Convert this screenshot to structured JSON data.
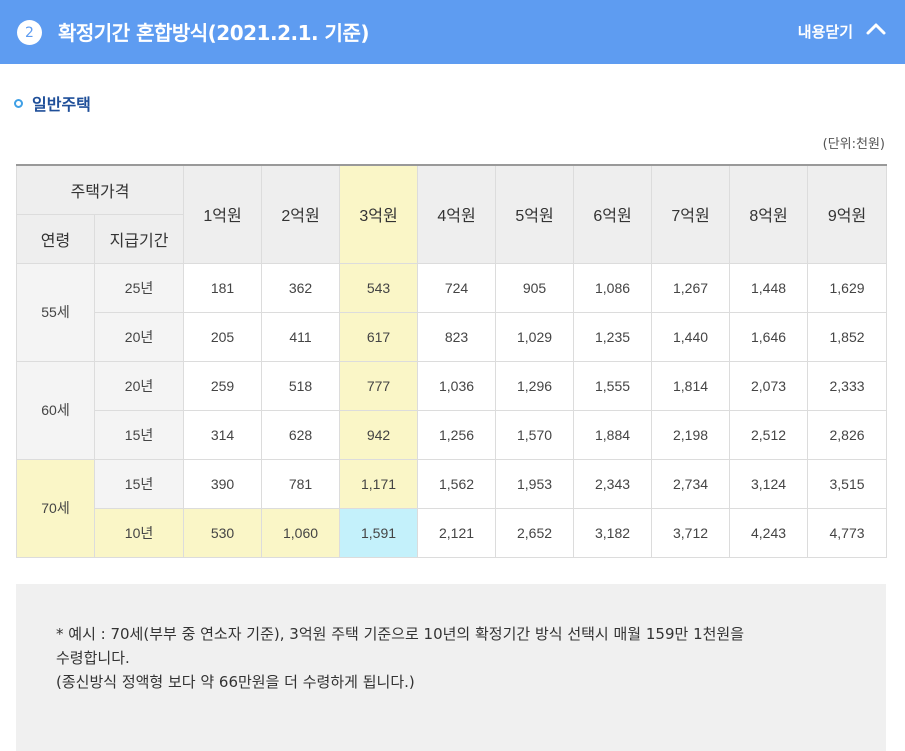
{
  "header": {
    "number": "2",
    "title": "확정기간 혼합방식(2021.2.1. 기준)",
    "close_label": "내용닫기"
  },
  "section": {
    "title": "일반주택"
  },
  "unit": "(단위:천원)",
  "table": {
    "header_price": "주택가격",
    "header_age": "연령",
    "header_period": "지급기간",
    "prices": [
      "1억원",
      "2억원",
      "3억원",
      "4억원",
      "5억원",
      "6억원",
      "7억원",
      "8억원",
      "9억원"
    ],
    "groups": [
      {
        "age": "55세",
        "rows": [
          {
            "period": "25년",
            "values": [
              "181",
              "362",
              "543",
              "724",
              "905",
              "1,086",
              "1,267",
              "1,448",
              "1,629"
            ]
          },
          {
            "period": "20년",
            "values": [
              "205",
              "411",
              "617",
              "823",
              "1,029",
              "1,235",
              "1,440",
              "1,646",
              "1,852"
            ]
          }
        ]
      },
      {
        "age": "60세",
        "rows": [
          {
            "period": "20년",
            "values": [
              "259",
              "518",
              "777",
              "1,036",
              "1,296",
              "1,555",
              "1,814",
              "2,073",
              "2,333"
            ]
          },
          {
            "period": "15년",
            "values": [
              "314",
              "628",
              "942",
              "1,256",
              "1,570",
              "1,884",
              "2,198",
              "2,512",
              "2,826"
            ]
          }
        ]
      },
      {
        "age": "70세",
        "rows": [
          {
            "period": "15년",
            "values": [
              "390",
              "781",
              "1,171",
              "1,562",
              "1,953",
              "2,343",
              "2,734",
              "3,124",
              "3,515"
            ]
          },
          {
            "period": "10년",
            "values": [
              "530",
              "1,060",
              "1,591",
              "2,121",
              "2,652",
              "3,182",
              "3,712",
              "4,243",
              "4,773"
            ]
          }
        ]
      }
    ]
  },
  "note": {
    "line1": "* 예시 : 70세(부부 중 연소자 기준), 3억원 주택 기준으로 10년의 확정기간 방식 선택시 매월 159만 1천원을",
    "line2": "수령합니다.",
    "line3": "(종신방식 정액형 보다 약 66만원을 더 수령하게 됩니다.)"
  },
  "colors": {
    "header_bg": "#5e9cf1",
    "highlight_yellow": "#faf6c7",
    "highlight_blue": "#c4f1fb",
    "section_title": "#1f4f99"
  }
}
